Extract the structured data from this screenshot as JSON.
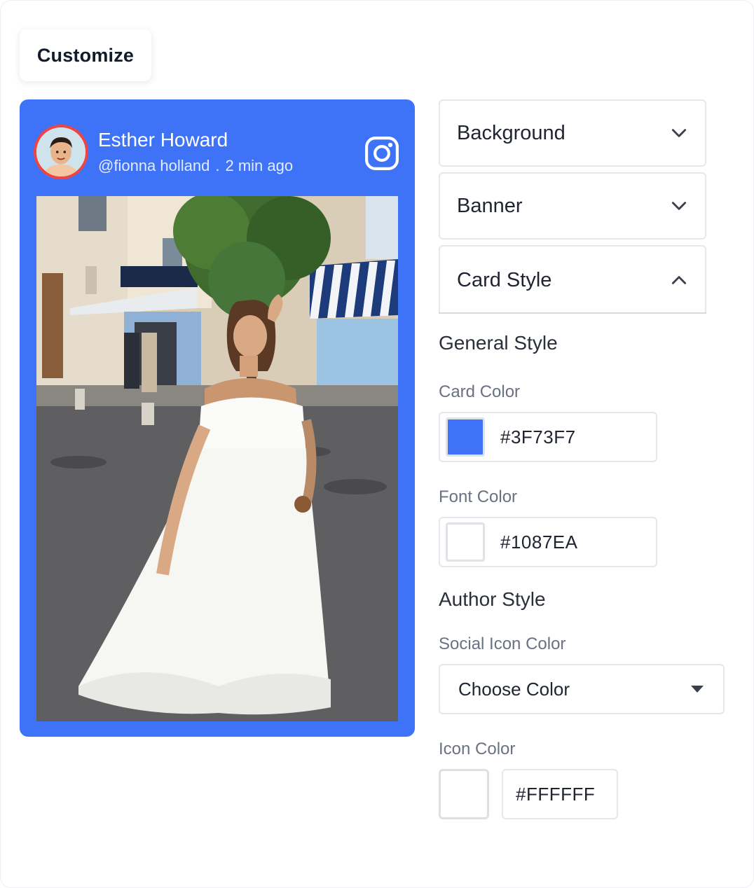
{
  "tab": {
    "label": "Customize"
  },
  "card": {
    "color": "#3F73F7",
    "author_name": "Esther Howard",
    "handle": "@fionna holland",
    "separator": ".",
    "time": "2 min ago",
    "social_icon": "instagram-icon"
  },
  "panel": {
    "accordions": [
      {
        "label": "Background",
        "state": "collapsed"
      },
      {
        "label": "Banner",
        "state": "collapsed"
      },
      {
        "label": "Card Style",
        "state": "expanded"
      }
    ],
    "general_style": {
      "title": "General Style",
      "card_color_label": "Card Color",
      "card_color_value": "#3F73F7",
      "font_color_label": "Font Color",
      "font_color_value": "#1087EA"
    },
    "author_style": {
      "title": "Author Style",
      "social_icon_color_label": "Social Icon Color",
      "social_icon_color_value": "Choose Color",
      "icon_color_label": "Icon Color",
      "icon_color_value": "#FFFFFF"
    }
  }
}
